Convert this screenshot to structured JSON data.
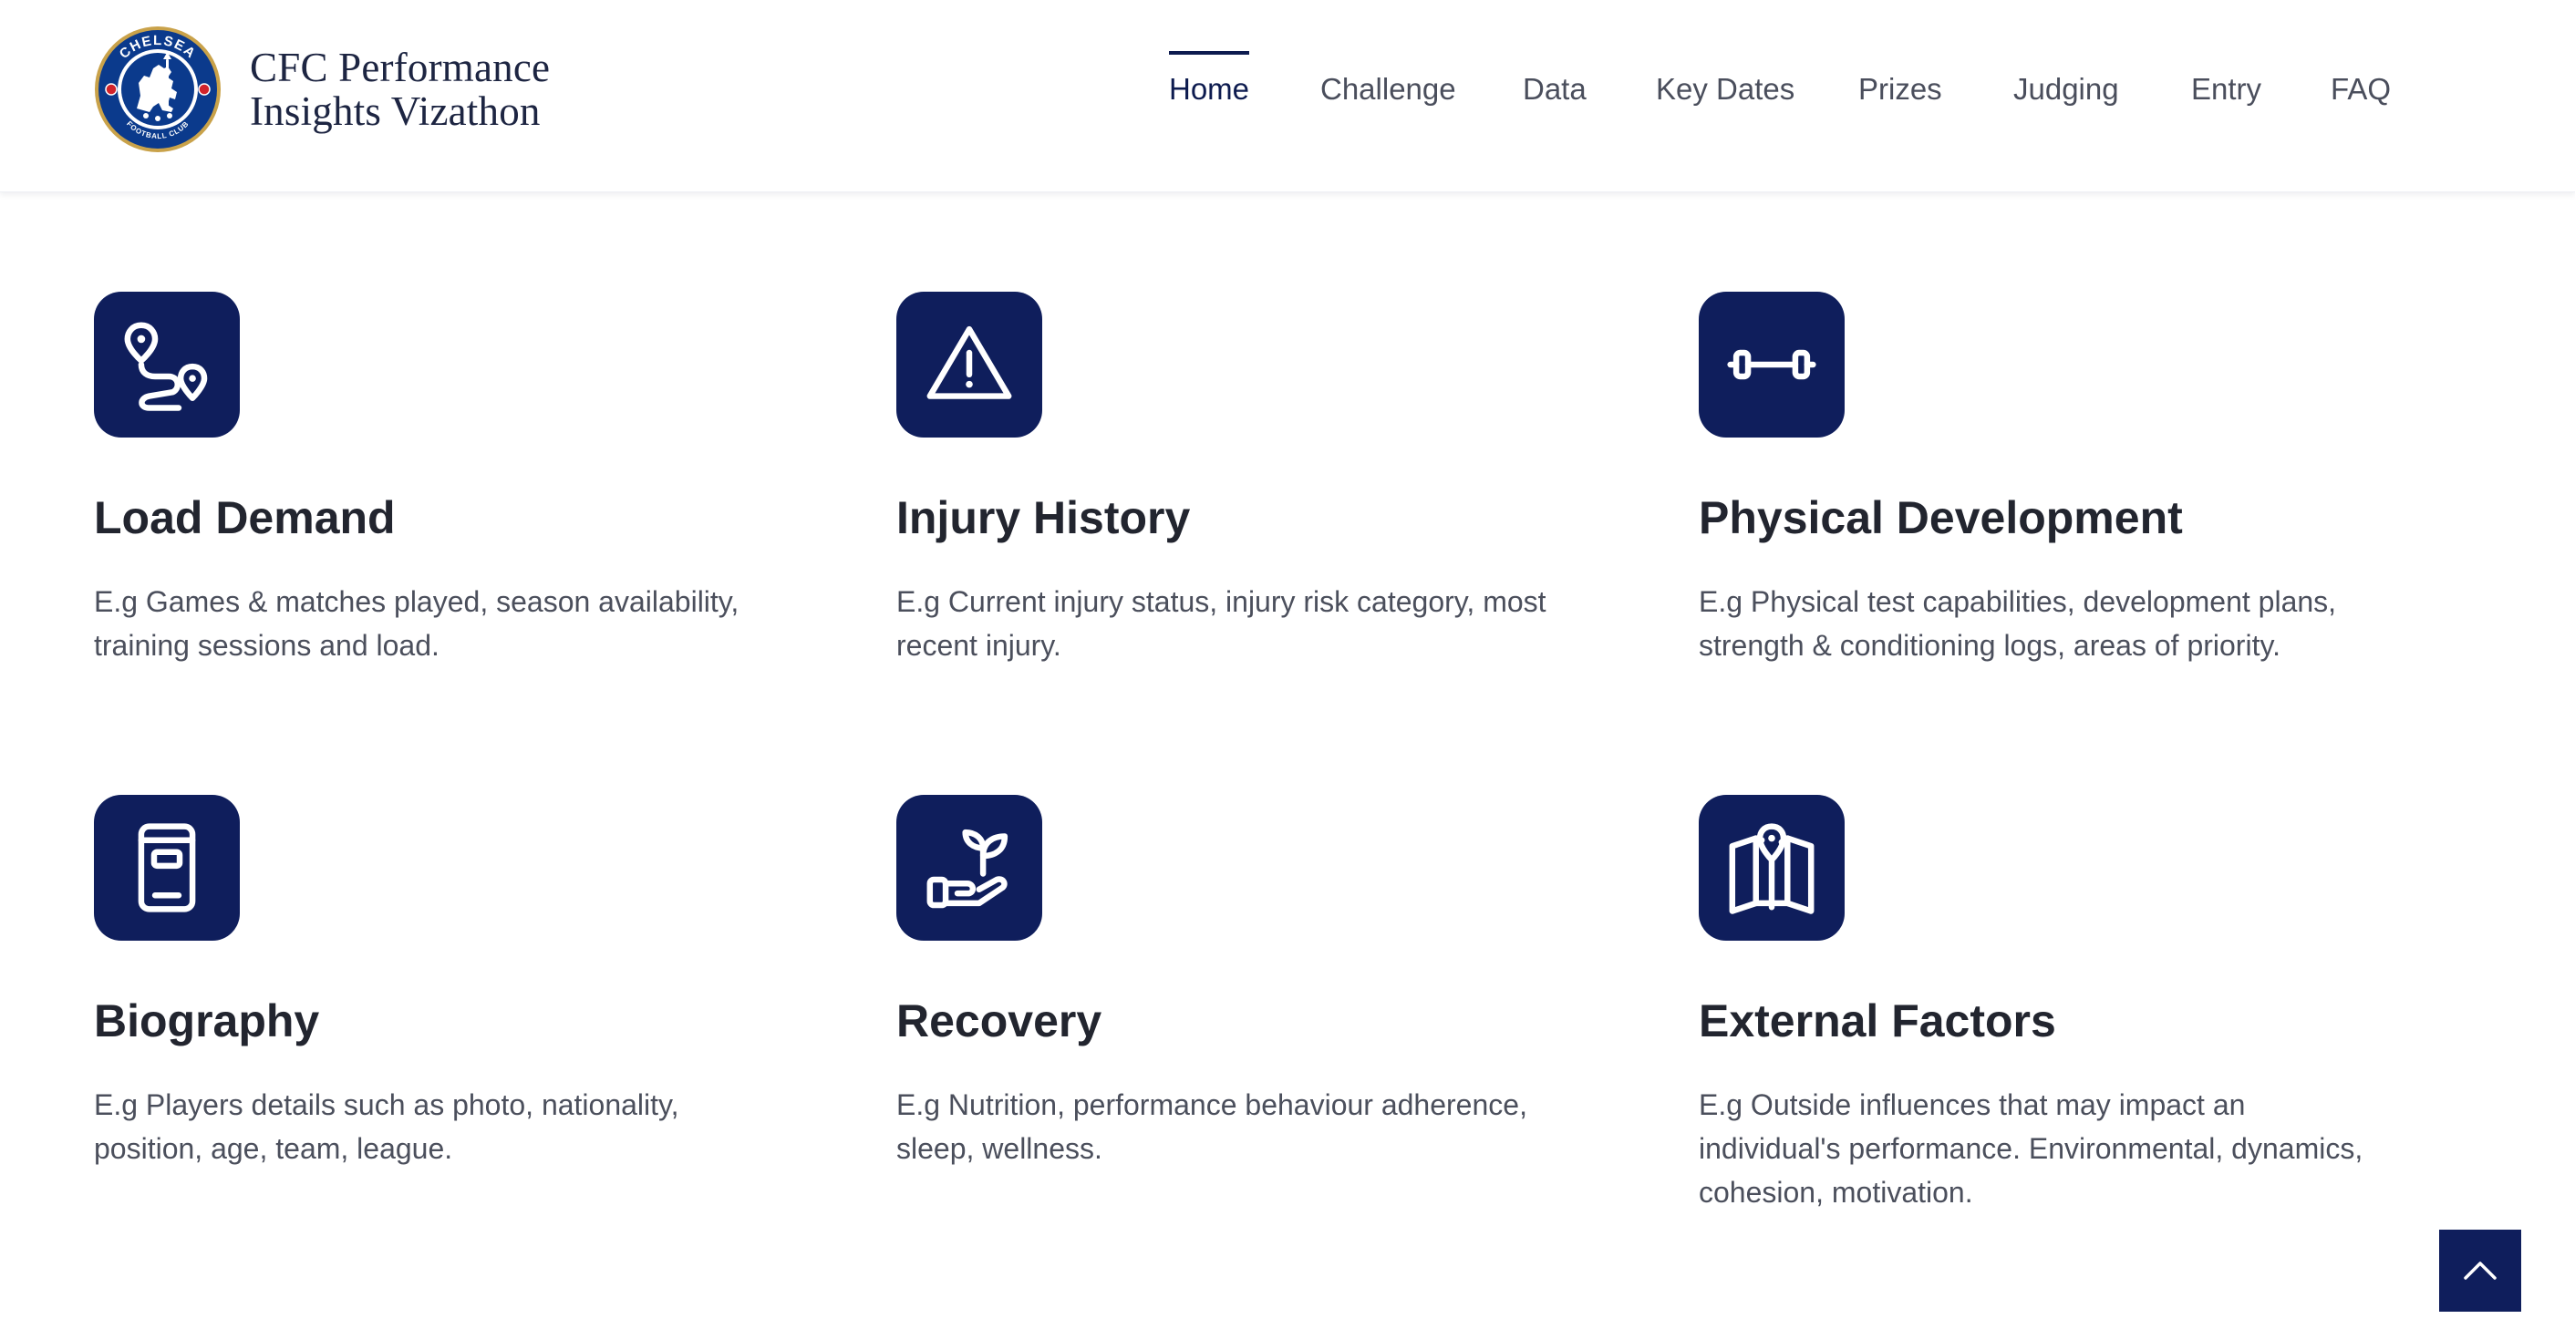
{
  "brand": {
    "line1": "CFC Performance",
    "line2": "Insights Vizathon",
    "logo_top_text": "CHELSEA",
    "logo_bottom_text": "FOOTBALL CLUB"
  },
  "nav": {
    "items": [
      {
        "label": "Home",
        "active": true
      },
      {
        "label": "Challenge"
      },
      {
        "label": "Data"
      },
      {
        "label": "Key Dates"
      },
      {
        "label": "Prizes"
      },
      {
        "label": "Judging"
      },
      {
        "label": "Entry"
      },
      {
        "label": "FAQ"
      }
    ]
  },
  "cards": [
    {
      "icon": "route-pins-icon",
      "title": "Load Demand",
      "desc": "E.g Games & matches played, season availability, training sessions and load."
    },
    {
      "icon": "warning-triangle-icon",
      "title": "Injury History",
      "desc": "E.g Current injury status, injury risk category, most recent injury."
    },
    {
      "icon": "dumbbell-icon",
      "title": "Physical Development",
      "desc": "E.g Physical test capabilities, development plans, strength & conditioning logs, areas of priority."
    },
    {
      "icon": "id-badge-icon",
      "title": "Biography",
      "desc": "E.g Players details such as photo, nationality, position, age, team, league."
    },
    {
      "icon": "hand-sprout-icon",
      "title": "Recovery",
      "desc": "E.g Nutrition, performance behaviour adherence, sleep, wellness."
    },
    {
      "icon": "map-pin-icon",
      "title": "External Factors",
      "desc": "E.g Outside influences that may impact an individual's performance. Environmental, dynamics, cohesion, motivation."
    }
  ],
  "colors": {
    "accent": "#0f1e5c",
    "nav_active": "#0d1b4f",
    "text_heading": "#22252f",
    "text_body": "#4b4f5c"
  },
  "scroll_top": {
    "icon": "chevron-up-icon"
  }
}
